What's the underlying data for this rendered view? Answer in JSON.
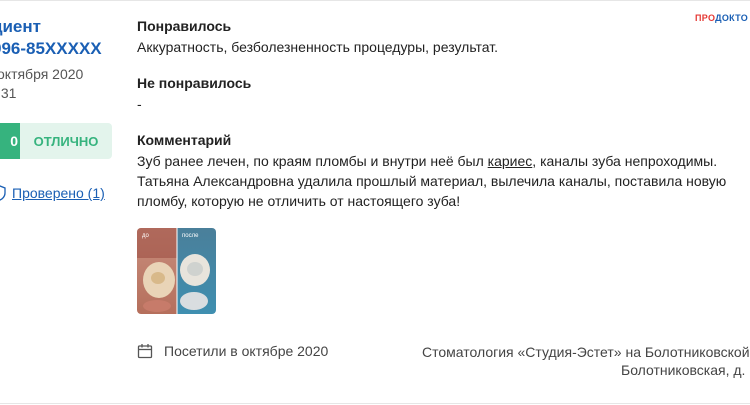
{
  "author": {
    "name": "циент",
    "phone": "996-85XXXXX",
    "date": "октября 2020",
    "time": ":31"
  },
  "rating": {
    "score": "0",
    "label": "ОТЛИЧНО",
    "score_color": "#36b37e",
    "label_bg": "#e3f4ec"
  },
  "verification": {
    "icon": "shield-check-icon",
    "link_text": "Проверено (1)"
  },
  "logo": {
    "part1": "ПРО",
    "part2": "ДОКТО"
  },
  "review": {
    "liked_title": "Понравилось",
    "liked_text": "Аккуратность, безболезненность процедуры, результат.",
    "disliked_title": "Не понравилось",
    "disliked_text": "-",
    "comment_title": "Комментарий",
    "comment_line1_before": "Зуб ранее лечен, по краям пломбы и внутри неё был ",
    "comment_line1_link": "кариес",
    "comment_line1_after": ", каналы зуба непроходимы.",
    "comment_line2": "Татьяна Александровна удалила прошлый материал, вылечила каналы, поставила новую",
    "comment_line3": "пломбу, которую не отличить от настоящего зуба!"
  },
  "photo": {
    "label_before": "до",
    "label_after": "после"
  },
  "visit": {
    "icon": "calendar-icon",
    "text": "Посетили в октябре 2020"
  },
  "clinic": {
    "line1": "Стоматология «Студия-Эстет» на Болотниковской",
    "line2": "Болотниковская, д."
  }
}
